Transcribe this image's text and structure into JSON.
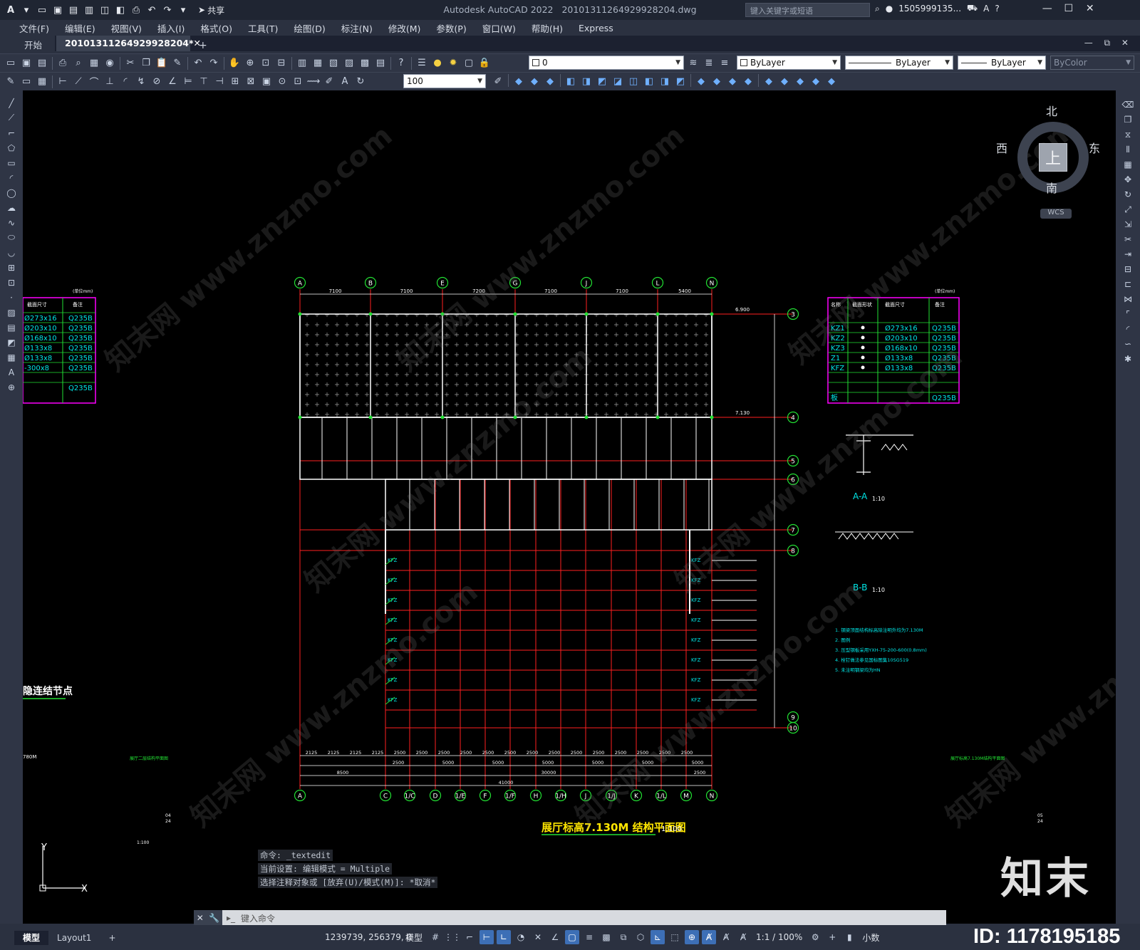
{
  "app": {
    "title": "Autodesk AutoCAD 2022",
    "filename": "20101311264929928204.dwg",
    "share_label": "共享",
    "search_placeholder": "键入关键字或短语",
    "user": "1505999135...",
    "logo": "A"
  },
  "menu": [
    "文件(F)",
    "编辑(E)",
    "视图(V)",
    "插入(I)",
    "格式(O)",
    "工具(T)",
    "绘图(D)",
    "标注(N)",
    "修改(M)",
    "参数(P)",
    "窗口(W)",
    "帮助(H)",
    "Express"
  ],
  "file_tabs": {
    "start": "开始",
    "active": "20101311264929928204*",
    "plus": "+"
  },
  "toolbar": {
    "layer_value": "0",
    "color_value": "ByLayer",
    "linetype_value": "ByLayer",
    "lineweight_value": "ByLayer",
    "plotstyle_value": "ByColor",
    "scale_value": "100"
  },
  "viewcube": {
    "north": "北",
    "south": "南",
    "east": "东",
    "west": "西",
    "face": "上",
    "wcs": "WCS"
  },
  "drawing": {
    "title": "展厅标高7.130M 结构平面图",
    "scale": "1:100",
    "grid_top": [
      "A",
      "B",
      "E",
      "G",
      "J",
      "L",
      "N"
    ],
    "grid_bottom": [
      "A",
      "C",
      "1/C",
      "D",
      "1/E",
      "F",
      "1/F",
      "H",
      "1/H",
      "J",
      "1/J",
      "K",
      "1/L",
      "M",
      "N"
    ],
    "grid_right": [
      "3",
      "4",
      "5",
      "6",
      "7",
      "8",
      "9",
      "10"
    ],
    "dims_top": [
      "7100",
      "7100",
      "7200",
      "7100",
      "7100",
      "5400"
    ],
    "dims_bottom_1": [
      "2125",
      "2125",
      "2125",
      "2125",
      "2500",
      "2500",
      "2500",
      "2500",
      "2500",
      "2500",
      "2500",
      "2500",
      "2500",
      "2500",
      "2500",
      "2500",
      "2500",
      "2500"
    ],
    "dims_bottom_2": [
      "2500",
      "5000",
      "5000",
      "5000",
      "5000",
      "5000",
      "5000"
    ],
    "dims_bottom_3": [
      "8500",
      "30000",
      "2500"
    ],
    "dims_total": "41000",
    "section_a": "A-A",
    "section_a_scale": "1:10",
    "section_b": "B-B",
    "section_b_scale": "1:10",
    "elev_1": "6.900",
    "elev_2": "7.130",
    "left_heading": "隐连结节点",
    "left_elev": "780M",
    "left_table": {
      "unit": "(单位mm)",
      "headers": [
        "截面尺寸",
        "备注"
      ],
      "rows": [
        [
          "Ø273x16",
          "Q235B"
        ],
        [
          "Ø203x10",
          "Q235B"
        ],
        [
          "Ø168x10",
          "Q235B"
        ],
        [
          "Ø133x8",
          "Q235B"
        ],
        [
          "Ø133x8",
          "Q235B"
        ],
        [
          "-300x8",
          "Q235B"
        ],
        [
          "",
          ""
        ],
        [
          "",
          "Q235B"
        ]
      ]
    },
    "right_table": {
      "unit": "(单位mm)",
      "headers": [
        "名称",
        "截面形状",
        "截面尺寸",
        "备注"
      ],
      "rows": [
        [
          "KZ1",
          "Ø273x16",
          "Q235B"
        ],
        [
          "KZ2",
          "Ø203x10",
          "Q235B"
        ],
        [
          "KZ3",
          "Ø168x10",
          "Q235B"
        ],
        [
          "Z1",
          "Ø133x8",
          "Q235B"
        ],
        [
          "KFZ",
          "Ø133x8",
          "Q235B"
        ],
        [
          "",
          "",
          ""
        ],
        [
          "",
          "",
          ""
        ],
        [
          "板",
          "",
          "Q235B"
        ]
      ]
    },
    "notes": [
      "1. 钢梁顶面结构标高除注明外均为7.130M",
      "2. 图例",
      "3. 压型钢板采用YXH-75-200-600(0.8mm)",
      "4. 栓钉做法参见国标图集10SG519",
      "5. 未注明钢梁均为HN"
    ],
    "left_scale": "1:100",
    "left_sheet": "展厅二层结构平面图",
    "right_sheet": "展厅标高7.130M结构平面图",
    "sheet_no_1": "04",
    "sheet_no_2": "05",
    "sheet_sub": "24"
  },
  "command": {
    "history": [
      "命令: _textedit",
      "当前设置: 编辑模式 = Multiple",
      "选择注释对象或 [放弃(U)/模式(M)]: *取消*"
    ],
    "placeholder": "键入命令"
  },
  "status": {
    "tab_model": "模型",
    "tab_layout": "Layout1",
    "coords": "1239739, 256379, 0",
    "mode": "模型",
    "scale": "1:1 / 100%",
    "units": "小数"
  },
  "brand": {
    "logo": "知末",
    "id": "ID: 1178195185",
    "watermark": "知末网 www.znzmo.com"
  },
  "colors": {
    "cad_bg": "#000000",
    "grid_red": "#ff2020",
    "cyan": "#00e5e5",
    "green": "#22e033",
    "magenta": "#ff00ff",
    "white": "#ffffff"
  }
}
